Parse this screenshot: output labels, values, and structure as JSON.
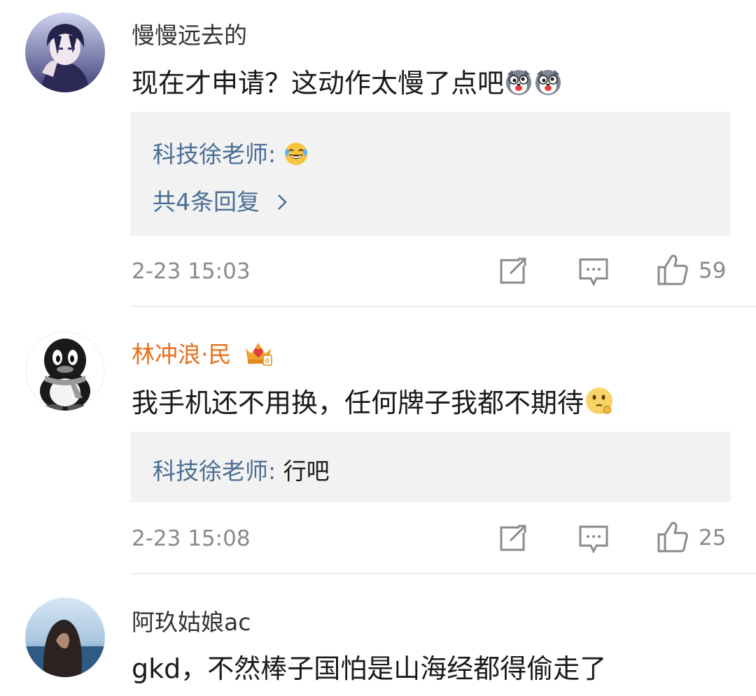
{
  "comments": [
    {
      "username": "慢慢远去的",
      "text": "现在才申请？这动作太慢了点吧",
      "emoji_names": [
        "dog-face-emoji",
        "dog-face-emoji"
      ],
      "reply": {
        "author": "科技徐老师:",
        "text": "",
        "emoji_name": "laughing-tears-emoji",
        "more": "共4条回复",
        "more_icon": "chevron-right-icon"
      },
      "time": "2-23 15:03",
      "likes": "59"
    },
    {
      "username": "林冲浪·民",
      "vip_badge": "crown-badge-icon",
      "text": "我手机还不用换，任何牌子我都不期待",
      "emoji_names": [
        "thinking-face-emoji"
      ],
      "reply": {
        "author": "科技徐老师:",
        "text": "行吧"
      },
      "time": "2-23 15:08",
      "likes": "25"
    },
    {
      "username": "阿玖姑娘ac",
      "text": "gkd，不然棒子国怕是山海经都得偷走了"
    }
  ],
  "actions": {
    "share_icon": "share-icon",
    "comment_icon": "comment-icon",
    "like_icon": "thumbs-up-icon"
  },
  "colors": {
    "username": "#333333",
    "vip_username": "#e8701a",
    "reply_author": "#4a6e95",
    "meta": "#8a8a8a",
    "reply_bg": "#f2f2f2"
  }
}
